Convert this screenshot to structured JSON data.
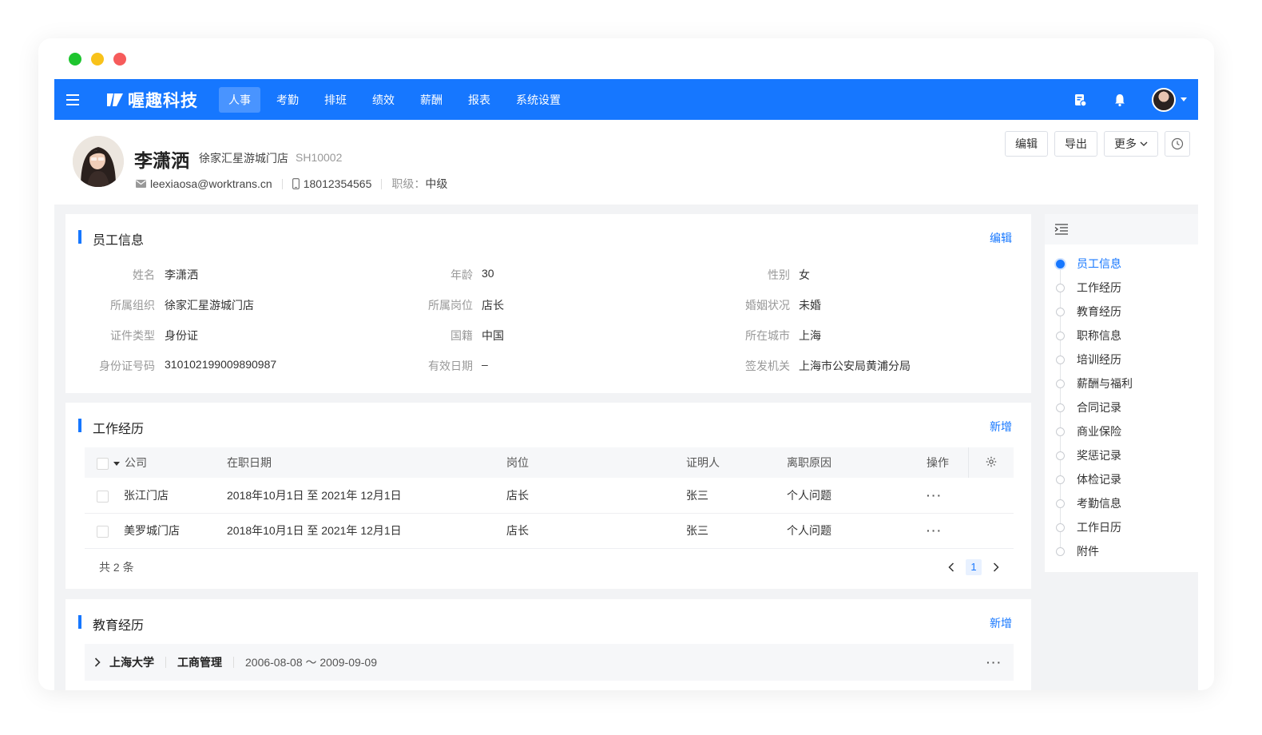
{
  "brand": {
    "name": "喔趣科技",
    "accent": "#1677ff"
  },
  "nav": {
    "items": [
      {
        "label": "人事",
        "active": true
      },
      {
        "label": "考勤"
      },
      {
        "label": "排班"
      },
      {
        "label": "绩效"
      },
      {
        "label": "薪酬"
      },
      {
        "label": "报表"
      },
      {
        "label": "系统设置"
      }
    ]
  },
  "topbar_icons": [
    "report-icon",
    "bell-icon",
    "user-avatar"
  ],
  "profile": {
    "name": "李潇洒",
    "store": "徐家汇星游城门店",
    "code": "SH10002",
    "email": "leexiaosa@worktrans.cn",
    "phone": "18012354565",
    "level_label": "职级：",
    "level": "中级"
  },
  "actions": {
    "edit": "编辑",
    "export": "导出",
    "more": "更多"
  },
  "employee_info": {
    "title": "员工信息",
    "edit_label": "编辑",
    "fields": [
      {
        "label": "姓名",
        "value": "李潇洒"
      },
      {
        "label": "年龄",
        "value": "30"
      },
      {
        "label": "性别",
        "value": "女"
      },
      {
        "label": "所属组织",
        "value": "徐家汇星游城门店"
      },
      {
        "label": "所属岗位",
        "value": "店长"
      },
      {
        "label": "婚姻状况",
        "value": "未婚"
      },
      {
        "label": "证件类型",
        "value": "身份证"
      },
      {
        "label": "国籍",
        "value": "中国"
      },
      {
        "label": "所在城市",
        "value": "上海"
      },
      {
        "label": "身份证号码",
        "value": "310102199009890987"
      },
      {
        "label": "有效日期",
        "value": "–"
      },
      {
        "label": "签发机关",
        "value": "上海市公安局黄浦分局"
      }
    ]
  },
  "work_history": {
    "title": "工作经历",
    "add_label": "新增",
    "columns": [
      "公司",
      "在职日期",
      "岗位",
      "证明人",
      "离职原因",
      "操作"
    ],
    "rows": [
      {
        "company": "张江门店",
        "dates": "2018年10月1日 至 2021年 12月1日",
        "position": "店长",
        "reference": "张三",
        "reason": "个人问题",
        "op": "···"
      },
      {
        "company": "美罗城门店",
        "dates": "2018年10月1日 至 2021年 12月1日",
        "position": "店长",
        "reference": "张三",
        "reason": "个人问题",
        "op": "···"
      }
    ],
    "total": "共 2 条",
    "page": "1"
  },
  "education": {
    "title": "教育经历",
    "add_label": "新增",
    "rows": [
      {
        "school": "上海大学",
        "major": "工商管理",
        "dates": "2006-08-08 ～ 2009-09-09",
        "op": "···"
      }
    ]
  },
  "toc": {
    "items": [
      {
        "label": "员工信息",
        "active": true
      },
      {
        "label": "工作经历"
      },
      {
        "label": "教育经历"
      },
      {
        "label": "职称信息"
      },
      {
        "label": "培训经历"
      },
      {
        "label": "薪酬与福利"
      },
      {
        "label": "合同记录"
      },
      {
        "label": "商业保险"
      },
      {
        "label": "奖惩记录"
      },
      {
        "label": "体检记录"
      },
      {
        "label": "考勤信息"
      },
      {
        "label": "工作日历"
      },
      {
        "label": "附件"
      }
    ]
  }
}
